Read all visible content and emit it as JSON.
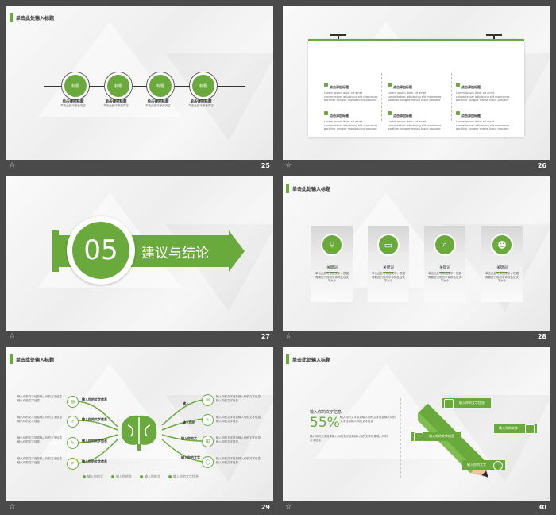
{
  "slides": [
    {
      "number": "25",
      "title": "单击此处输入标题",
      "nodes": [
        {
          "label": "标题",
          "caption": "单击键相标题",
          "desc": "单击此处可添加内容"
        },
        {
          "label": "标题",
          "caption": "单击键相标题",
          "desc": "单击此处可添加内容"
        },
        {
          "label": "标题",
          "caption": "单击键相标题",
          "desc": "单击此处可添加内容"
        },
        {
          "label": "标题",
          "caption": "单击键相标题",
          "desc": "单击此处可添加内容"
        }
      ]
    },
    {
      "number": "26",
      "items": [
        {
          "title": "点击添加标题",
          "text": "Lorem ipsum dolor sit amet consectetuer adipiscing elit maecenas porttitor congue massa fusce posuere"
        },
        {
          "title": "点击添加标题",
          "text": "Lorem ipsum dolor sit amet consectetuer adipiscing elit maecenas porttitor congue massa fusce posuere"
        },
        {
          "title": "点击添加标题",
          "text": "Lorem ipsum dolor sit amet consectetuer adipiscing elit maecenas porttitor congue massa fusce posuere"
        },
        {
          "title": "点击添加标题",
          "text": "Lorem ipsum dolor sit amet consectetuer adipiscing elit maecenas porttitor congue massa fusce posuere"
        },
        {
          "title": "点击添加标题",
          "text": "Lorem ipsum dolor sit amet consectetuer adipiscing elit maecenas porttitor congue massa fusce posuere"
        },
        {
          "title": "点击添加标题",
          "text": "Lorem ipsum dolor sit amet consectetuer adipiscing elit maecenas porttitor congue massa fusce posuere"
        }
      ]
    },
    {
      "number": "27",
      "section_number": "05",
      "section_title": "建议与结论"
    },
    {
      "number": "28",
      "title": "单击此处输入标题",
      "cards": [
        {
          "keyword": "关键词",
          "desc": "单击此处可添加文字，根据需要进行修改字体颜色及文字大小"
        },
        {
          "keyword": "关键词",
          "desc": "单击此处可添加文字，根据需要进行修改字体颜色及文字大小"
        },
        {
          "keyword": "关键词",
          "desc": "单击此处可添加文字，根据需要进行修改字体颜色及文字大小"
        },
        {
          "keyword": "关键词",
          "desc": "单击此处可添加文字，根据需要进行修改字体颜色及文字大小"
        }
      ]
    },
    {
      "number": "29",
      "title": "单击此处输入标题",
      "left_labels": [
        "输入你的文字信息",
        "输入你的文字信息",
        "输入你的文字信息",
        "输入你的文字信息"
      ],
      "right_labels": [
        "输入",
        "输入你的",
        "输入你的文",
        "输入你的文字"
      ],
      "body_text": "输入你的文字信息输入你的文字信息输入你的文字信息",
      "legend": [
        "输入你的文",
        "输入你的文",
        "输入你的文",
        "输入你的文字信息"
      ]
    },
    {
      "number": "30",
      "title": "单击此处输入标题",
      "heading": "输入你的文字信息",
      "percent": "55%",
      "body_text": "输入你的文字信息输入你的文字信息输入你的文字信息输入你的文字信息",
      "tags": [
        {
          "title": "输入你的文字信息",
          "text": "你的文字信息"
        },
        {
          "title": "输入你的文字",
          "text": "你的文字信息"
        },
        {
          "title": "输入你的文字信息",
          "text": "你的文字信息"
        },
        {
          "title": "输入你的文字",
          "text": "你的文字信息"
        }
      ]
    }
  ],
  "colors": {
    "accent": "#6aaa3c",
    "background": "#4a4a4a"
  }
}
